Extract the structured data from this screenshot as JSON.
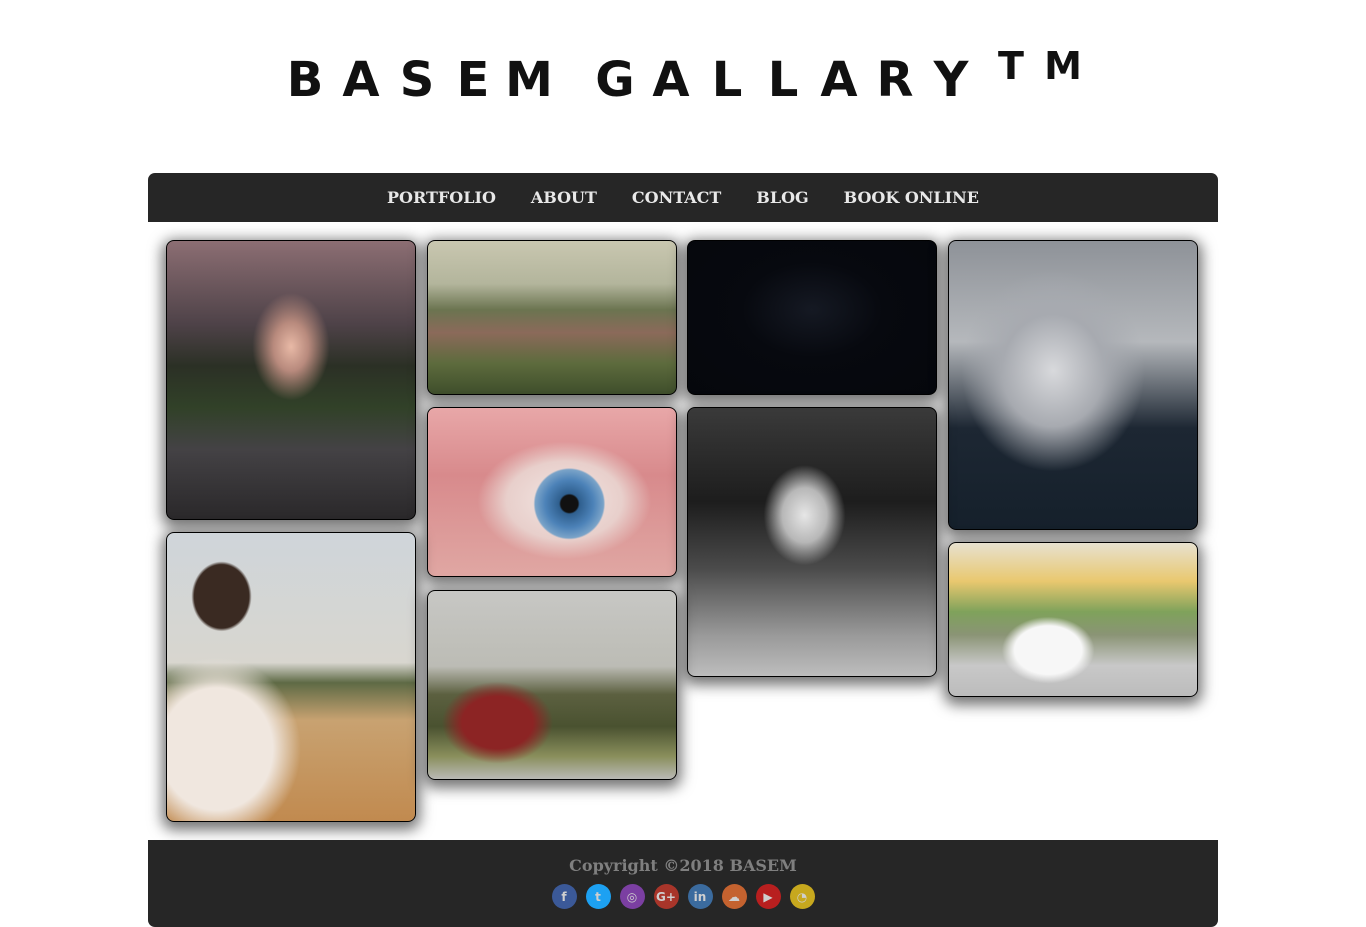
{
  "header": {
    "title_word1": [
      "B",
      "A",
      "S",
      "E",
      "M"
    ],
    "title_word2": [
      "G",
      "A",
      "L",
      "L",
      "A",
      "R",
      "Y"
    ],
    "tm": [
      "T",
      "M"
    ]
  },
  "nav": {
    "items": [
      "PORTFOLIO",
      "ABOUT",
      "CONTACT",
      "BLOG",
      "BOOK ONLINE"
    ]
  },
  "gallery": {
    "photos": [
      "park-path",
      "citadel-view",
      "black-cat",
      "smoke-portrait",
      "blue-eye",
      "arched-corridor",
      "man-looking-away",
      "white-car-street",
      "man-sitting-hill"
    ]
  },
  "footer": {
    "copyright": "Copyright ©2018 BASEM",
    "social": [
      {
        "icon": "facebook-icon",
        "glyph": "f",
        "color": "#3b5998"
      },
      {
        "icon": "twitter-icon",
        "glyph": "t",
        "color": "#1da1f2"
      },
      {
        "icon": "instagram-icon",
        "glyph": "◎",
        "color": "#7b3fa2"
      },
      {
        "icon": "google-plus-icon",
        "glyph": "G+",
        "color": "#a8352a"
      },
      {
        "icon": "linkedin-icon",
        "glyph": "in",
        "color": "#3b6b9e"
      },
      {
        "icon": "soundcloud-icon",
        "glyph": "☁",
        "color": "#c4622f"
      },
      {
        "icon": "youtube-icon",
        "glyph": "▶",
        "color": "#b81f1f"
      },
      {
        "icon": "snapchat-icon",
        "glyph": "◔",
        "color": "#c7a81e"
      }
    ]
  }
}
